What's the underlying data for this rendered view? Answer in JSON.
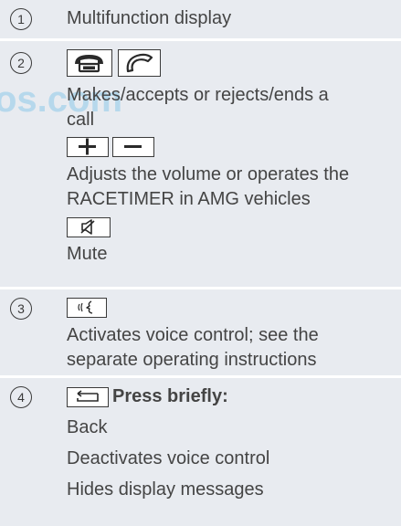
{
  "watermark": "os.com",
  "rows": [
    {
      "number": "1",
      "lines": [
        "Multifunction display"
      ]
    },
    {
      "number": "2",
      "desc_call": "Makes/accepts or rejects/ends a call",
      "desc_call_l1": "Makes/accepts or rejects/ends a",
      "desc_call_l2": "call",
      "desc_vol_l1": "Adjusts the volume or operates the",
      "desc_vol_l2": "RACETIMER in AMG vehicles",
      "desc_mute": "Mute",
      "icons": [
        "hang-up-phone-icon",
        "pick-up-phone-icon",
        "plus-icon",
        "minus-icon",
        "mute-icon"
      ]
    },
    {
      "number": "3",
      "desc_l1": "Activates voice control; see the",
      "desc_l2": "separate operating instructions",
      "icons": [
        "voice-control-icon"
      ]
    },
    {
      "number": "4",
      "press_label": "Press briefly:",
      "lines": [
        "Back",
        "Deactivates voice control",
        "Hides display messages"
      ],
      "icons": [
        "back-icon"
      ]
    }
  ]
}
